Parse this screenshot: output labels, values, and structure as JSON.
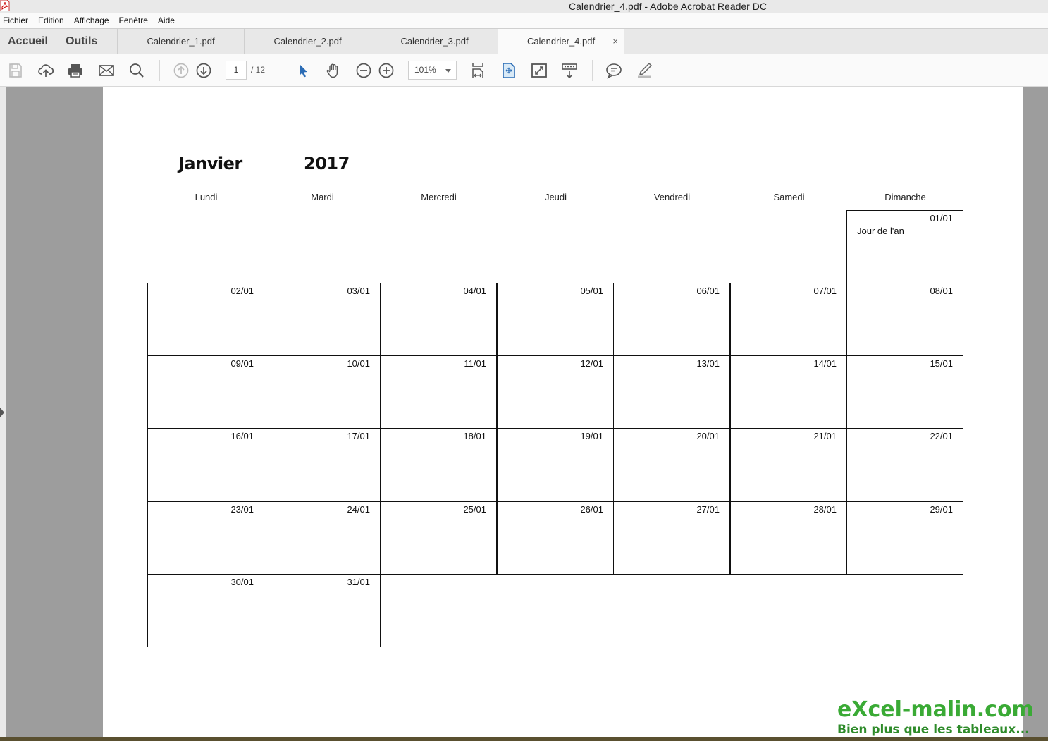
{
  "window": {
    "title": "Calendrier_4.pdf - Adobe Acrobat Reader DC"
  },
  "menu": [
    "Fichier",
    "Edition",
    "Affichage",
    "Fenêtre",
    "Aide"
  ],
  "nav": {
    "home": "Accueil",
    "tools": "Outils"
  },
  "tabs": [
    {
      "label": "Calendrier_1.pdf",
      "active": false
    },
    {
      "label": "Calendrier_2.pdf",
      "active": false
    },
    {
      "label": "Calendrier_3.pdf",
      "active": false
    },
    {
      "label": "Calendrier_4.pdf",
      "active": true,
      "close": "×"
    }
  ],
  "toolbar": {
    "icons": [
      "save-icon",
      "upload-cloud-icon",
      "print-icon",
      "email-icon",
      "search-icon",
      "previous-page-icon",
      "next-page-icon",
      "select-cursor-icon",
      "hand-tool-icon",
      "zoom-out-icon",
      "zoom-in-icon",
      "fit-width-icon",
      "fit-page-icon",
      "fullscreen-icon",
      "read-mode-icon",
      "comment-icon",
      "highlight-pen-icon"
    ],
    "page_current": "1",
    "page_total": "/ 12",
    "zoom": "101%"
  },
  "calendar": {
    "month": "Janvier",
    "year": "2017",
    "days": [
      "Lundi",
      "Mardi",
      "Mercredi",
      "Jeudi",
      "Vendredi",
      "Samedi",
      "Dimanche"
    ],
    "weeks": [
      [
        null,
        null,
        null,
        null,
        null,
        null,
        {
          "date": "01/01",
          "note": "Jour de l'an"
        }
      ],
      [
        {
          "date": "02/01"
        },
        {
          "date": "03/01"
        },
        {
          "date": "04/01"
        },
        {
          "date": "05/01"
        },
        {
          "date": "06/01"
        },
        {
          "date": "07/01"
        },
        {
          "date": "08/01"
        }
      ],
      [
        {
          "date": "09/01"
        },
        {
          "date": "10/01"
        },
        {
          "date": "11/01"
        },
        {
          "date": "12/01"
        },
        {
          "date": "13/01"
        },
        {
          "date": "14/01"
        },
        {
          "date": "15/01"
        }
      ],
      [
        {
          "date": "16/01"
        },
        {
          "date": "17/01"
        },
        {
          "date": "18/01"
        },
        {
          "date": "19/01"
        },
        {
          "date": "20/01"
        },
        {
          "date": "21/01"
        },
        {
          "date": "22/01"
        }
      ],
      [
        {
          "date": "23/01"
        },
        {
          "date": "24/01"
        },
        {
          "date": "25/01"
        },
        {
          "date": "26/01"
        },
        {
          "date": "27/01"
        },
        {
          "date": "28/01"
        },
        {
          "date": "29/01"
        }
      ],
      [
        {
          "date": "30/01"
        },
        {
          "date": "31/01"
        },
        null,
        null,
        null,
        null,
        null
      ]
    ]
  },
  "watermark": {
    "line1": "eXcel-malin.com",
    "line2": "Bien plus que les tableaux..."
  }
}
